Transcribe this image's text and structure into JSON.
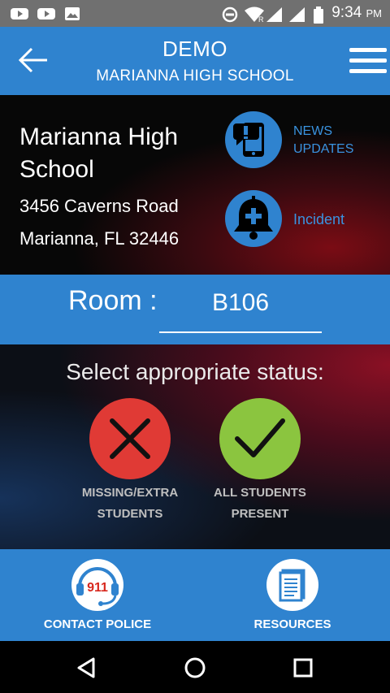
{
  "status_bar": {
    "time": "9:34",
    "ampm": "PM",
    "icons": [
      "youtube-icon",
      "youtube-icon",
      "photo-icon",
      "dnd-icon",
      "wifi-icon",
      "signal-icon",
      "signal-icon",
      "battery-icon"
    ]
  },
  "header": {
    "title": "DEMO",
    "subtitle": "MARIANNA HIGH SCHOOL",
    "icons": [
      "back-arrow-icon",
      "menu-icon"
    ]
  },
  "school": {
    "name": "Marianna High School",
    "address_line1": "3456 Caverns Road",
    "address_line2": "Marianna, FL 32446",
    "news_label_line1": "NEWS",
    "news_label_line2": "UPDATES",
    "incident_label": "Incident"
  },
  "room": {
    "label": "Room :",
    "value": "B106"
  },
  "status_panel": {
    "title": "Select appropriate status:",
    "missing_line1": "MISSING/EXTRA",
    "missing_line2": "STUDENTS",
    "present_line1": "ALL STUDENTS",
    "present_line2": "PRESENT"
  },
  "bottom_bar": {
    "contact_label": "CONTACT POLICE",
    "resources_label": "RESOURCES",
    "badge_text": "911"
  },
  "colors": {
    "brand_blue": "#2f83cf",
    "label_blue": "#3a93e0",
    "missing_red": "#e03a35",
    "present_green": "#8bc53f"
  }
}
